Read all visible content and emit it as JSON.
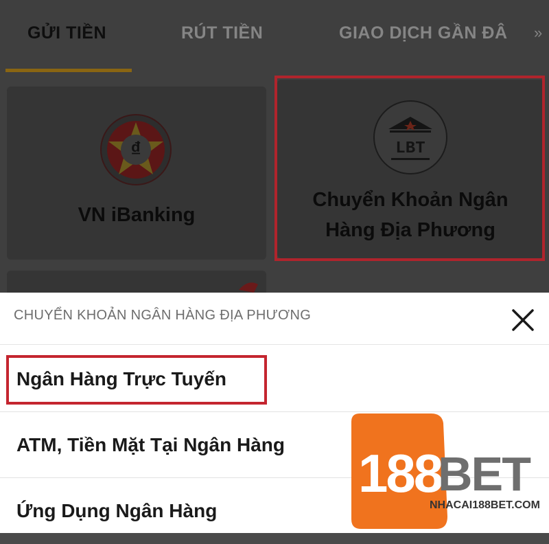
{
  "tabs": [
    {
      "label": "GỬI TIỀN",
      "active": true
    },
    {
      "label": "RÚT TIỀN",
      "active": false
    },
    {
      "label": "GIAO DỊCH GẦN ĐÂ",
      "active": false
    }
  ],
  "tab_more": "»",
  "methods": [
    {
      "label": "VN iBanking",
      "icon": "dong-coin-icon",
      "symbol": "₫"
    },
    {
      "label_line1": "Chuyển Khoản Ngân",
      "label_line2": "Hàng Địa Phương",
      "icon": "bank-building-icon",
      "badge": "LBT"
    }
  ],
  "sheet": {
    "title": "CHUYỂN KHOẢN NGÂN HÀNG ĐỊA PHƯƠNG",
    "options": [
      {
        "label": "Ngân Hàng Trực Tuyến"
      },
      {
        "label": "ATM, Tiền Mặt Tại Ngân Hàng"
      },
      {
        "label": "Ứng Dụng Ngân Hàng"
      }
    ]
  },
  "watermark": {
    "brand_num": "188",
    "brand_word": "BET",
    "site": "NHACAI188BET.COM"
  },
  "colors": {
    "accent_gold": "#8a6512",
    "highlight_red": "#c4252f",
    "logo_orange": "#f0731e"
  }
}
